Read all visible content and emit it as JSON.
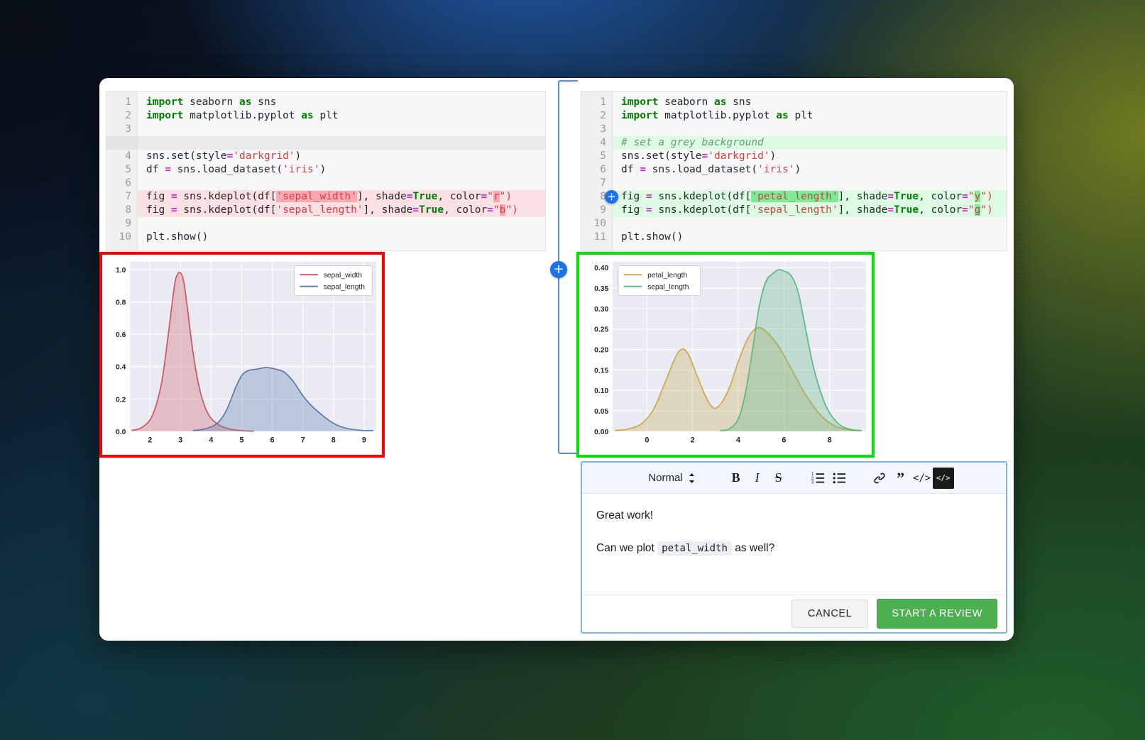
{
  "background": {
    "accent_blue": "#1e56a8",
    "accent_olive": "#6f7a1c",
    "accent_green": "#1d5e2a",
    "accent_teal": "#0c3440"
  },
  "diff": {
    "left": {
      "name": "original-code-panel",
      "highlight_color": "#fbe0e4",
      "lines": [
        {
          "n": "1",
          "kind": "ctx",
          "tokens": [
            {
              "t": "import",
              "c": "kw"
            },
            {
              "t": " seaborn ",
              "c": ""
            },
            {
              "t": "as",
              "c": "kw"
            },
            {
              "t": " sns",
              "c": ""
            }
          ]
        },
        {
          "n": "2",
          "kind": "ctx",
          "tokens": [
            {
              "t": "import",
              "c": "kw"
            },
            {
              "t": " matplotlib.pyplot ",
              "c": ""
            },
            {
              "t": "as",
              "c": "kw"
            },
            {
              "t": " plt",
              "c": ""
            }
          ]
        },
        {
          "n": "3",
          "kind": "ctx",
          "tokens": []
        },
        {
          "n": "",
          "kind": "gap",
          "tokens": []
        },
        {
          "n": "4",
          "kind": "ctx",
          "tokens": [
            {
              "t": "sns.set(style",
              "c": ""
            },
            {
              "t": "=",
              "c": "op"
            },
            {
              "t": "'darkgrid'",
              "c": "str"
            },
            {
              "t": ")",
              "c": ""
            }
          ]
        },
        {
          "n": "5",
          "kind": "ctx",
          "tokens": [
            {
              "t": "df ",
              "c": ""
            },
            {
              "t": "=",
              "c": "op"
            },
            {
              "t": " sns.load_dataset(",
              "c": ""
            },
            {
              "t": "'iris'",
              "c": "str"
            },
            {
              "t": ")",
              "c": ""
            }
          ]
        },
        {
          "n": "6",
          "kind": "ctx",
          "tokens": []
        },
        {
          "n": "7",
          "kind": "del",
          "tokens": [
            {
              "t": "fig ",
              "c": ""
            },
            {
              "t": "=",
              "c": "op"
            },
            {
              "t": " sns.kdeplot(df[",
              "c": ""
            },
            {
              "t": "'sepal_width'",
              "c": "str hl-del"
            },
            {
              "t": "], shade",
              "c": ""
            },
            {
              "t": "=",
              "c": "op"
            },
            {
              "t": "True",
              "c": "kw"
            },
            {
              "t": ", color",
              "c": ""
            },
            {
              "t": "=",
              "c": "op"
            },
            {
              "t": "\"",
              "c": "str"
            },
            {
              "t": "r",
              "c": "str hl-del"
            },
            {
              "t": "\")",
              "c": "str"
            }
          ]
        },
        {
          "n": "8",
          "kind": "del",
          "tokens": [
            {
              "t": "fig ",
              "c": ""
            },
            {
              "t": "=",
              "c": "op"
            },
            {
              "t": " sns.kdeplot(df[",
              "c": ""
            },
            {
              "t": "'sepal_length'",
              "c": "str"
            },
            {
              "t": "], shade",
              "c": ""
            },
            {
              "t": "=",
              "c": "op"
            },
            {
              "t": "True",
              "c": "kw"
            },
            {
              "t": ", color",
              "c": ""
            },
            {
              "t": "=",
              "c": "op"
            },
            {
              "t": "\"",
              "c": "str"
            },
            {
              "t": "b",
              "c": "str hl-del"
            },
            {
              "t": "\")",
              "c": "str"
            }
          ]
        },
        {
          "n": "9",
          "kind": "ctx",
          "tokens": []
        },
        {
          "n": "10",
          "kind": "ctx",
          "tokens": [
            {
              "t": "plt.show()",
              "c": ""
            }
          ]
        }
      ]
    },
    "right": {
      "name": "modified-code-panel",
      "highlight_color": "#ddfbe2",
      "comment_anchor_line": "8",
      "lines": [
        {
          "n": "1",
          "kind": "ctx",
          "tokens": [
            {
              "t": "import",
              "c": "kw"
            },
            {
              "t": " seaborn ",
              "c": ""
            },
            {
              "t": "as",
              "c": "kw"
            },
            {
              "t": " sns",
              "c": ""
            }
          ]
        },
        {
          "n": "2",
          "kind": "ctx",
          "tokens": [
            {
              "t": "import",
              "c": "kw"
            },
            {
              "t": " matplotlib.pyplot ",
              "c": ""
            },
            {
              "t": "as",
              "c": "kw"
            },
            {
              "t": " plt",
              "c": ""
            }
          ]
        },
        {
          "n": "3",
          "kind": "ctx",
          "tokens": []
        },
        {
          "n": "4",
          "kind": "add",
          "tokens": [
            {
              "t": "# set a grey background",
              "c": "cm"
            }
          ]
        },
        {
          "n": "5",
          "kind": "ctx",
          "tokens": [
            {
              "t": "sns.set(style",
              "c": ""
            },
            {
              "t": "=",
              "c": "op"
            },
            {
              "t": "'darkgrid'",
              "c": "str"
            },
            {
              "t": ")",
              "c": ""
            }
          ]
        },
        {
          "n": "6",
          "kind": "ctx",
          "tokens": [
            {
              "t": "df ",
              "c": ""
            },
            {
              "t": "=",
              "c": "op"
            },
            {
              "t": " sns.load_dataset(",
              "c": ""
            },
            {
              "t": "'iris'",
              "c": "str"
            },
            {
              "t": ")",
              "c": ""
            }
          ]
        },
        {
          "n": "7",
          "kind": "ctx",
          "tokens": []
        },
        {
          "n": "8",
          "kind": "add",
          "tokens": [
            {
              "t": "fig ",
              "c": ""
            },
            {
              "t": "=",
              "c": "op"
            },
            {
              "t": " sns.kdeplot(df[",
              "c": ""
            },
            {
              "t": "'petal_length'",
              "c": "str hl-add"
            },
            {
              "t": "], shade",
              "c": ""
            },
            {
              "t": "=",
              "c": "op"
            },
            {
              "t": "True",
              "c": "kw"
            },
            {
              "t": ", color",
              "c": ""
            },
            {
              "t": "=",
              "c": "op"
            },
            {
              "t": "\"",
              "c": "str"
            },
            {
              "t": "y",
              "c": "str hl-add"
            },
            {
              "t": "\")",
              "c": "str"
            }
          ]
        },
        {
          "n": "9",
          "kind": "add",
          "tokens": [
            {
              "t": "fig ",
              "c": ""
            },
            {
              "t": "=",
              "c": "op"
            },
            {
              "t": " sns.kdeplot(df[",
              "c": ""
            },
            {
              "t": "'sepal_length'",
              "c": "str"
            },
            {
              "t": "], shade",
              "c": ""
            },
            {
              "t": "=",
              "c": "op"
            },
            {
              "t": "True",
              "c": "kw"
            },
            {
              "t": ", color",
              "c": ""
            },
            {
              "t": "=",
              "c": "op"
            },
            {
              "t": "\"",
              "c": "str"
            },
            {
              "t": "g",
              "c": "str hl-add"
            },
            {
              "t": "\")",
              "c": "str"
            }
          ]
        },
        {
          "n": "10",
          "kind": "ctx",
          "tokens": []
        },
        {
          "n": "11",
          "kind": "ctx",
          "tokens": [
            {
              "t": "plt.show()",
              "c": ""
            }
          ]
        }
      ]
    }
  },
  "chart_data": [
    {
      "name": "left-kde-plot",
      "type": "area",
      "border_color": "#ff0000",
      "title": "",
      "xlabel": "",
      "ylabel": "",
      "xticks": [
        2,
        3,
        4,
        5,
        6,
        7,
        8,
        9
      ],
      "yticks": [
        0.0,
        0.2,
        0.4,
        0.6,
        0.8,
        1.0
      ],
      "xlim": [
        1.35,
        9.4
      ],
      "ylim": [
        0.0,
        1.05
      ],
      "grid": true,
      "legend_position": "upper right",
      "series": [
        {
          "name": "sepal_width",
          "color": "#cc5560",
          "peak_x": 3.0,
          "peak_y": 0.98,
          "x": [
            1.4,
            1.7,
            2.0,
            2.2,
            2.4,
            2.6,
            2.8,
            2.9,
            3.0,
            3.1,
            3.2,
            3.4,
            3.6,
            3.8,
            4.0,
            4.3,
            4.6,
            5.0,
            5.4
          ],
          "y": [
            0.005,
            0.02,
            0.07,
            0.16,
            0.32,
            0.6,
            0.9,
            0.97,
            0.98,
            0.93,
            0.8,
            0.5,
            0.28,
            0.15,
            0.08,
            0.035,
            0.015,
            0.004,
            0.001
          ]
        },
        {
          "name": "sepal_length",
          "color": "#5577aa",
          "peak_x": 5.8,
          "peak_y": 0.395,
          "x": [
            3.4,
            3.8,
            4.2,
            4.5,
            4.8,
            5.0,
            5.2,
            5.5,
            5.8,
            6.1,
            6.4,
            6.7,
            7.0,
            7.3,
            7.6,
            8.0,
            8.4,
            8.9,
            9.3
          ],
          "y": [
            0.005,
            0.015,
            0.05,
            0.13,
            0.27,
            0.345,
            0.375,
            0.385,
            0.395,
            0.385,
            0.365,
            0.305,
            0.22,
            0.155,
            0.105,
            0.05,
            0.02,
            0.006,
            0.004
          ]
        }
      ]
    },
    {
      "name": "right-kde-plot",
      "type": "area",
      "border_color": "#00e500",
      "title": "",
      "xlabel": "",
      "ylabel": "",
      "xticks": [
        0,
        2,
        4,
        6,
        8
      ],
      "yticks": [
        0.0,
        0.05,
        0.1,
        0.15,
        0.2,
        0.25,
        0.3,
        0.35,
        0.4
      ],
      "xlim": [
        -1.5,
        9.6
      ],
      "ylim": [
        0.0,
        0.415
      ],
      "grid": true,
      "legend_position": "upper left",
      "series": [
        {
          "name": "petal_length",
          "color": "#c8a94b",
          "peaks": [
            {
              "x": 1.5,
              "y": 0.2
            },
            {
              "x": 4.8,
              "y": 0.252
            }
          ],
          "x": [
            -1.4,
            -0.8,
            -0.2,
            0.3,
            0.8,
            1.2,
            1.5,
            1.8,
            2.2,
            2.6,
            2.9,
            3.2,
            3.6,
            4.0,
            4.4,
            4.8,
            5.2,
            5.8,
            6.4,
            7.0,
            7.6,
            8.2,
            8.8,
            9.4
          ],
          "y": [
            0.002,
            0.006,
            0.02,
            0.055,
            0.12,
            0.175,
            0.2,
            0.19,
            0.135,
            0.082,
            0.058,
            0.065,
            0.105,
            0.17,
            0.225,
            0.252,
            0.245,
            0.205,
            0.145,
            0.085,
            0.04,
            0.014,
            0.004,
            0.001
          ]
        },
        {
          "name": "sepal_length",
          "color": "#58b784",
          "peaks": [
            {
              "x": 5.75,
              "y": 0.395
            }
          ],
          "x": [
            3.2,
            3.6,
            4.0,
            4.3,
            4.6,
            4.9,
            5.2,
            5.5,
            5.75,
            6.0,
            6.3,
            6.6,
            6.9,
            7.2,
            7.5,
            7.9,
            8.4,
            8.9,
            9.4
          ],
          "y": [
            0.001,
            0.006,
            0.03,
            0.09,
            0.19,
            0.3,
            0.365,
            0.385,
            0.395,
            0.392,
            0.382,
            0.345,
            0.265,
            0.18,
            0.115,
            0.055,
            0.018,
            0.005,
            0.002
          ]
        }
      ]
    }
  ],
  "editor": {
    "name": "review-comment-editor",
    "toolbar": {
      "style_label": "Normal",
      "style_caret_icon": "updown-caret-icon",
      "buttons": [
        {
          "icon": "bold-icon",
          "glyph": "B",
          "active": false
        },
        {
          "icon": "italic-icon",
          "glyph": "I",
          "active": false
        },
        {
          "icon": "strikethrough-icon",
          "glyph": "S",
          "active": false
        },
        {
          "icon": "ordered-list-icon",
          "glyph": "",
          "active": false
        },
        {
          "icon": "bulleted-list-icon",
          "glyph": "",
          "active": false
        },
        {
          "icon": "link-icon",
          "glyph": "",
          "active": false
        },
        {
          "icon": "blockquote-icon",
          "glyph": "”",
          "active": false
        },
        {
          "icon": "inline-code-icon",
          "glyph": "</>",
          "active": false
        },
        {
          "icon": "code-block-icon",
          "glyph": "</>",
          "active": true
        }
      ]
    },
    "comment": {
      "line1": "Great work!",
      "line2_before": "Can we plot ",
      "line2_code": "petal_width",
      "line2_after": " as well?"
    },
    "cancel_label": "CANCEL",
    "review_label": "START A REVIEW",
    "review_color": "#4caf50"
  }
}
